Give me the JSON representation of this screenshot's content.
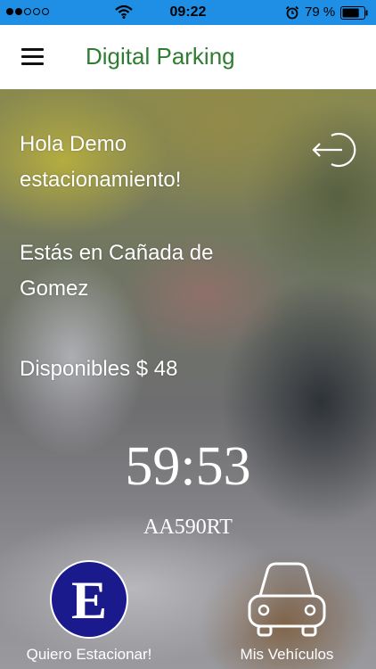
{
  "status_bar": {
    "time": "09:22",
    "battery": "79 %",
    "signal_bars": 2,
    "signal_total": 5,
    "battery_level": 0.79
  },
  "header": {
    "title": "Digital Parking",
    "title_color": "#2e7d32"
  },
  "main": {
    "greeting": "Hola Demo estacionamiento!",
    "location": "Estás en Cañada de Gomez",
    "balance": "Disponibles $ 48",
    "timer": "59:53",
    "plate": "AA590RT"
  },
  "actions": {
    "park_icon_letter": "E",
    "park_label": "Quiero Estacionar!",
    "vehicles_label": "Mis Vehículos"
  },
  "icons": [
    "signal-dots-icon",
    "wifi-icon",
    "alarm-icon",
    "battery-icon",
    "menu-icon",
    "logout-icon",
    "car-icon"
  ]
}
